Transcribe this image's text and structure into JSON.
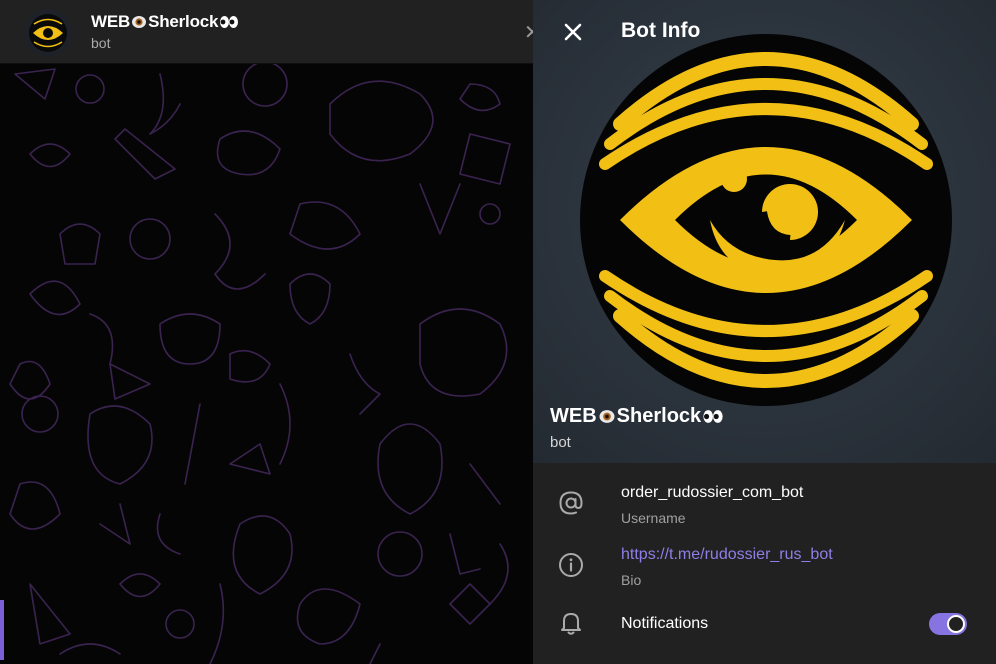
{
  "chat": {
    "title": "WEB",
    "title_suffix": "Sherlock",
    "subtitle": "bot"
  },
  "info": {
    "header_title": "Bot Info",
    "name": "WEB",
    "name_suffix": "Sherlock",
    "name_sub": "bot",
    "username": "order_rudossier_com_bot",
    "username_label": "Username",
    "bio": "https://t.me/rudossier_rus_bot",
    "bio_label": "Bio",
    "notifications_label": "Notifications",
    "notifications_on": true
  },
  "colors": {
    "accent": "#8774e1",
    "link": "#8f7ee6",
    "logo_yellow": "#f2c014",
    "doodle": "#3b2350"
  }
}
